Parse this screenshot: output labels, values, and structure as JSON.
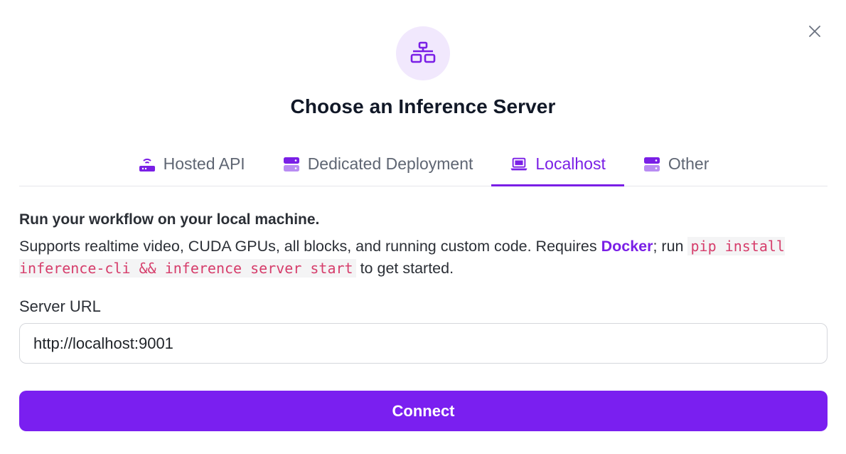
{
  "dialog": {
    "title": "Choose an Inference Server",
    "close_icon": "close-icon",
    "header_icon": "network-icon",
    "accent_color": "#7a1fe6"
  },
  "tabs": [
    {
      "label": "Hosted API",
      "icon": "router-icon",
      "active": false
    },
    {
      "label": "Dedicated Deployment",
      "icon": "server-icon",
      "active": false
    },
    {
      "label": "Localhost",
      "icon": "laptop-icon",
      "active": true
    },
    {
      "label": "Other",
      "icon": "server-icon",
      "active": false
    }
  ],
  "description": {
    "heading": "Run your workflow on your local machine.",
    "text_before_link": "Supports realtime video, CUDA GPUs, all blocks, and running custom code. Requires ",
    "link_label": "Docker",
    "text_after_link": "; run ",
    "code": "pip install inference-cli && inference server start",
    "text_end": " to get started."
  },
  "server_url": {
    "label": "Server URL",
    "value": "http://localhost:9001"
  },
  "connect_button": {
    "label": "Connect"
  }
}
